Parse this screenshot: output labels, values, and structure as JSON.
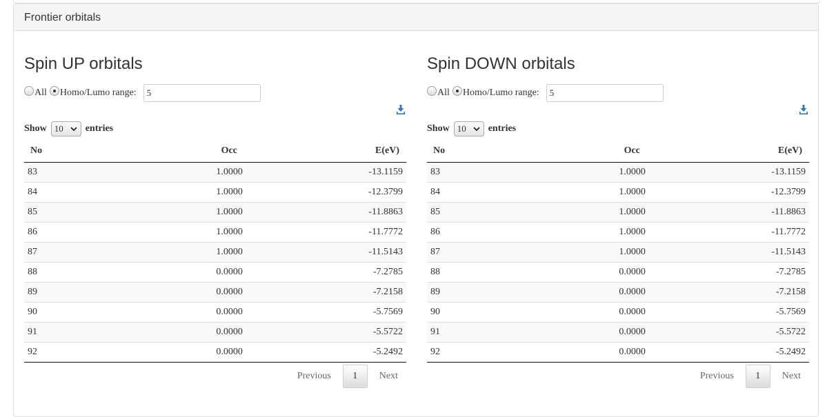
{
  "panel": {
    "title": "Frontier orbitals"
  },
  "left": {
    "title": "Spin UP orbitals",
    "radio_all": "All",
    "radio_range": "Homo/Lumo range:",
    "range_value": "5",
    "show": "Show",
    "entries_value": "10",
    "entries": "entries",
    "headers": [
      "No",
      "Occ",
      "E(eV)"
    ],
    "rows": [
      [
        "83",
        "1.0000",
        "-13.1159"
      ],
      [
        "84",
        "1.0000",
        "-12.3799"
      ],
      [
        "85",
        "1.0000",
        "-11.8863"
      ],
      [
        "86",
        "1.0000",
        "-11.7772"
      ],
      [
        "87",
        "1.0000",
        "-11.5143"
      ],
      [
        "88",
        "0.0000",
        "-7.2785"
      ],
      [
        "89",
        "0.0000",
        "-7.2158"
      ],
      [
        "90",
        "0.0000",
        "-5.7569"
      ],
      [
        "91",
        "0.0000",
        "-5.5722"
      ],
      [
        "92",
        "0.0000",
        "-5.2492"
      ]
    ],
    "prev": "Previous",
    "page": "1",
    "next": "Next"
  },
  "right": {
    "title": "Spin DOWN orbitals",
    "radio_all": "All",
    "radio_range": "Homo/Lumo range:",
    "range_value": "5",
    "show": "Show",
    "entries_value": "10",
    "entries": "entries",
    "headers": [
      "No",
      "Occ",
      "E(eV)"
    ],
    "rows": [
      [
        "83",
        "1.0000",
        "-13.1159"
      ],
      [
        "84",
        "1.0000",
        "-12.3799"
      ],
      [
        "85",
        "1.0000",
        "-11.8863"
      ],
      [
        "86",
        "1.0000",
        "-11.7772"
      ],
      [
        "87",
        "1.0000",
        "-11.5143"
      ],
      [
        "88",
        "0.0000",
        "-7.2785"
      ],
      [
        "89",
        "0.0000",
        "-7.2158"
      ],
      [
        "90",
        "0.0000",
        "-5.7569"
      ],
      [
        "91",
        "0.0000",
        "-5.5722"
      ],
      [
        "92",
        "0.0000",
        "-5.2492"
      ]
    ],
    "prev": "Previous",
    "page": "1",
    "next": "Next"
  },
  "colors": {
    "accent": "#337ab7",
    "panel_heading_bg": "#f5f5f5",
    "border": "#dddddd"
  },
  "icons": {
    "download": "download-icon",
    "select": "chevron-down-icon"
  }
}
